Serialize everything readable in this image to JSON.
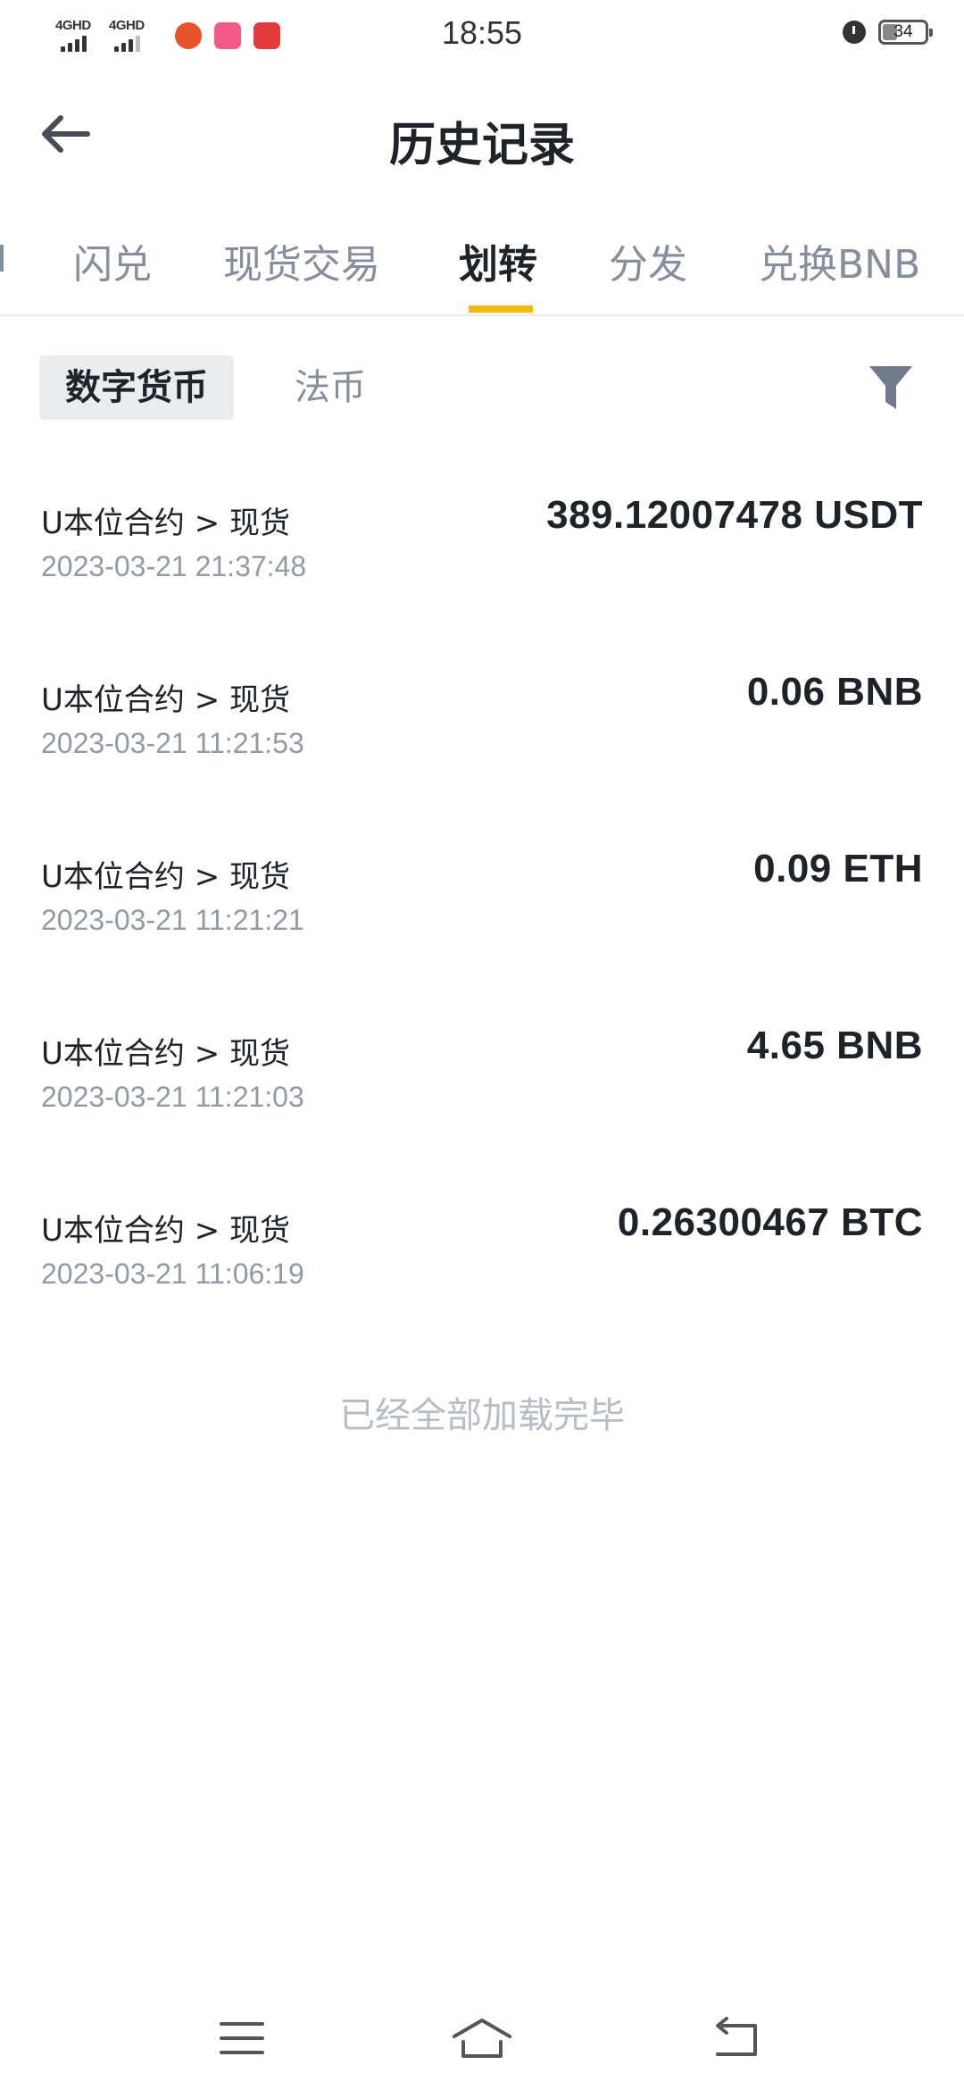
{
  "status_bar": {
    "time": "18:55",
    "signal_1": "4GHD",
    "signal_2": "4GHD",
    "battery": "34",
    "icons": [
      "signal-icon",
      "signal-icon",
      "app-icon",
      "app-icon",
      "app-icon",
      "alarm-icon",
      "battery-icon"
    ]
  },
  "header": {
    "title": "历史记录"
  },
  "tabs": {
    "items": [
      "闪兑",
      "现货交易",
      "划转",
      "分发",
      "兑换BNB"
    ],
    "active_index": 2
  },
  "sub_tabs": {
    "items": [
      "数字货币",
      "法币"
    ],
    "active_index": 0
  },
  "records": [
    {
      "route": "U本位合约 > 现货",
      "time": "2023-03-21 21:37:48",
      "amount": "389.12007478 USDT"
    },
    {
      "route": "U本位合约 > 现货",
      "time": "2023-03-21 11:21:53",
      "amount": "0.06 BNB"
    },
    {
      "route": "U本位合约 > 现货",
      "time": "2023-03-21 11:21:21",
      "amount": "0.09 ETH"
    },
    {
      "route": "U本位合约 > 现货",
      "time": "2023-03-21 11:21:03",
      "amount": "4.65 BNB"
    },
    {
      "route": "U本位合约 > 现货",
      "time": "2023-03-21 11:06:19",
      "amount": "0.26300467 BTC"
    }
  ],
  "end_text": "已经全部加载完毕",
  "colors": {
    "accent": "#f0b90b",
    "text_primary": "#1e2329",
    "text_secondary": "#848e9c",
    "subtab_bg": "#eaecef"
  }
}
